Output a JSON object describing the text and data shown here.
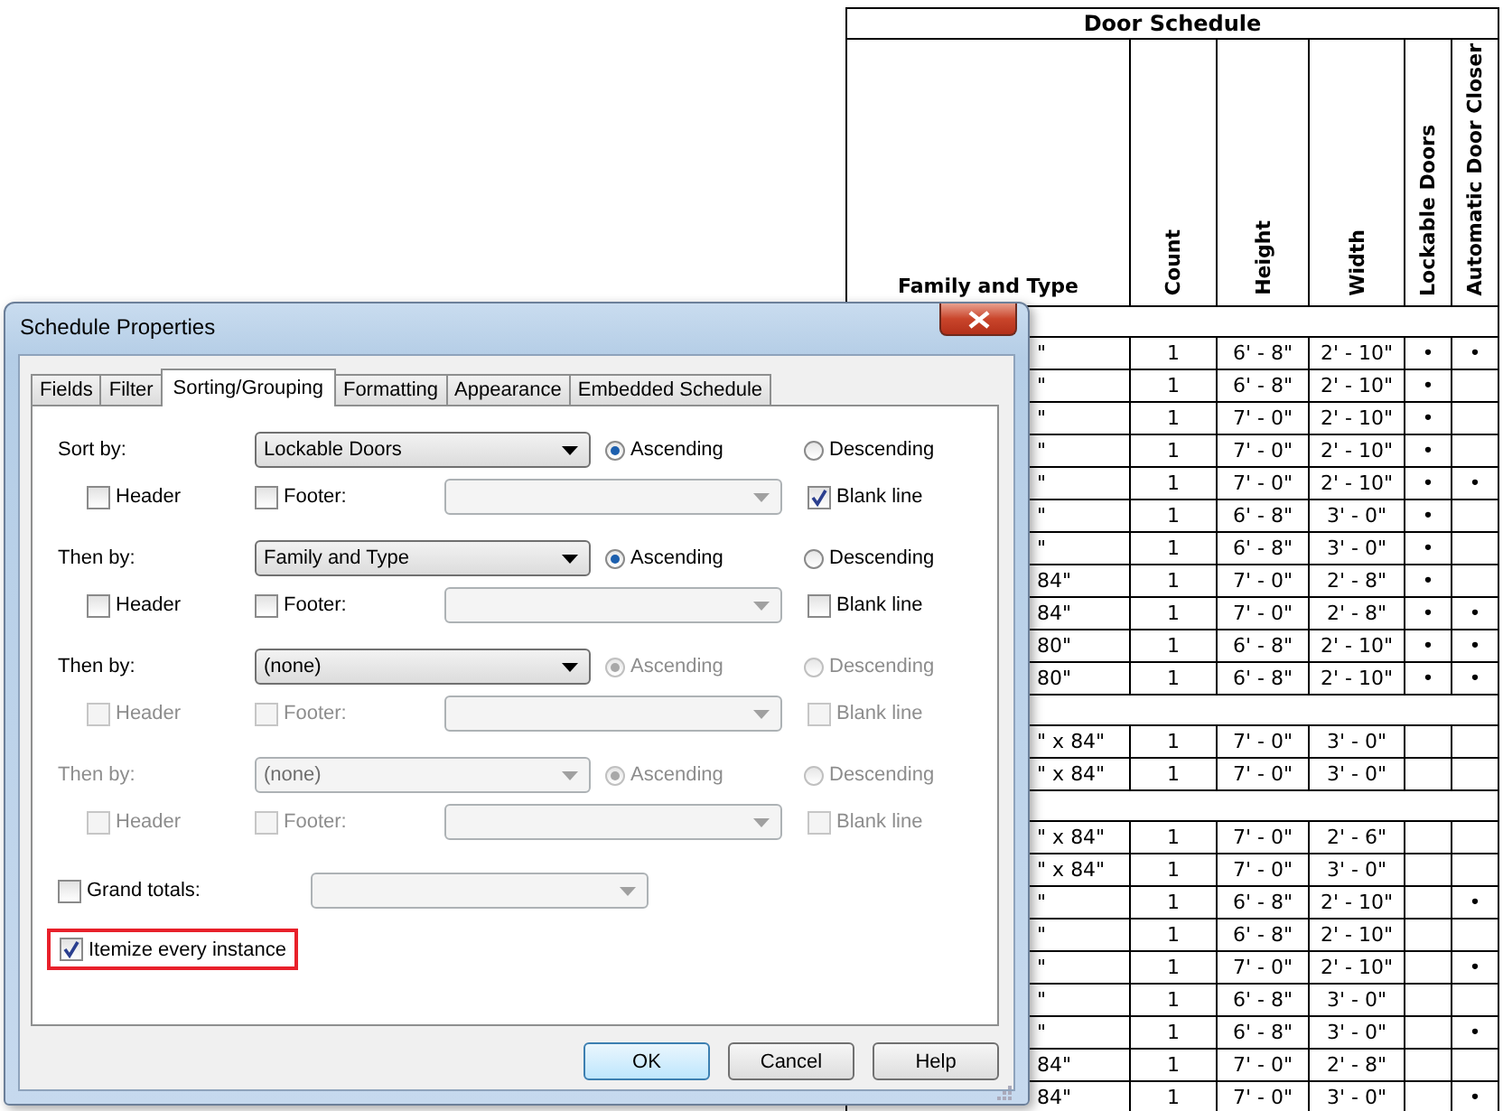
{
  "schedule": {
    "title": "Door Schedule",
    "columns": [
      {
        "label": "Family and Type",
        "vertical": false
      },
      {
        "label": "Count",
        "vertical": true
      },
      {
        "label": "Height",
        "vertical": true
      },
      {
        "label": "Width",
        "vertical": true
      },
      {
        "label": "Lockable Doors",
        "vertical": true
      },
      {
        "label": "Automatic Door Closer",
        "vertical": true
      }
    ],
    "groups": [
      {
        "rows": [
          [
            "\"",
            "1",
            "6' - 8\"",
            "2' - 10\"",
            "•",
            "•"
          ],
          [
            "\"",
            "1",
            "6' - 8\"",
            "2' - 10\"",
            "•",
            null
          ],
          [
            "\"",
            "1",
            "7' - 0\"",
            "2' - 10\"",
            "•",
            null
          ],
          [
            "\"",
            "1",
            "7' - 0\"",
            "2' - 10\"",
            "•",
            null
          ],
          [
            "\"",
            "1",
            "7' - 0\"",
            "2' - 10\"",
            "•",
            "•"
          ],
          [
            "\"",
            "1",
            "6' - 8\"",
            "3' - 0\"",
            "•",
            null
          ],
          [
            "\"",
            "1",
            "6' - 8\"",
            "3' - 0\"",
            "•",
            null
          ],
          [
            "84\"",
            "1",
            "7' - 0\"",
            "2' - 8\"",
            "•",
            null
          ],
          [
            "84\"",
            "1",
            "7' - 0\"",
            "2' - 8\"",
            "•",
            "•"
          ],
          [
            "80\"",
            "1",
            "6' - 8\"",
            "2' - 10\"",
            "•",
            "•"
          ],
          [
            "80\"",
            "1",
            "6' - 8\"",
            "2' - 10\"",
            "•",
            "•"
          ]
        ]
      },
      {
        "rows": [
          [
            "\" x 84\"",
            "1",
            "7' - 0\"",
            "3' - 0\"",
            null,
            null
          ],
          [
            "\" x 84\"",
            "1",
            "7' - 0\"",
            "3' - 0\"",
            null,
            null
          ]
        ]
      },
      {
        "rows": [
          [
            "\" x 84\"",
            "1",
            "7' - 0\"",
            "2' - 6\"",
            null,
            null
          ],
          [
            "\" x 84\"",
            "1",
            "7' - 0\"",
            "3' - 0\"",
            null,
            null
          ],
          [
            "\"",
            "1",
            "6' - 8\"",
            "2' - 10\"",
            null,
            "•"
          ],
          [
            "\"",
            "1",
            "6' - 8\"",
            "2' - 10\"",
            null,
            null
          ],
          [
            "\"",
            "1",
            "7' - 0\"",
            "2' - 10\"",
            null,
            "•"
          ],
          [
            "\"",
            "1",
            "6' - 8\"",
            "3' - 0\"",
            null,
            null
          ],
          [
            "\"",
            "1",
            "6' - 8\"",
            "3' - 0\"",
            null,
            "•"
          ],
          [
            "84\"",
            "1",
            "7' - 0\"",
            "2' - 8\"",
            null,
            null
          ],
          [
            "84\"",
            "1",
            "7' - 0\"",
            "3' - 0\"",
            null,
            "•"
          ]
        ]
      }
    ]
  },
  "dialog": {
    "title": "Schedule Properties",
    "tabs": [
      {
        "label": "Fields",
        "selected": false
      },
      {
        "label": "Filter",
        "selected": false
      },
      {
        "label": "Sorting/Grouping",
        "selected": true
      },
      {
        "label": "Formatting",
        "selected": false
      },
      {
        "label": "Appearance",
        "selected": false
      },
      {
        "label": "Embedded Schedule",
        "selected": false
      }
    ],
    "sort_groups": [
      {
        "label": "Sort by:",
        "disabled": false,
        "field": {
          "value": "Lockable Doors",
          "disabled": false
        },
        "ascending": {
          "label": "Ascending",
          "selected": true,
          "disabled": false
        },
        "descending": {
          "label": "Descending",
          "selected": false,
          "disabled": false
        },
        "header": {
          "label": "Header",
          "checked": false,
          "disabled": false
        },
        "footer": {
          "label": "Footer:",
          "checked": false,
          "disabled": false
        },
        "blank_line": {
          "label": "Blank line",
          "checked": true,
          "disabled": false
        }
      },
      {
        "label": "Then by:",
        "disabled": false,
        "field": {
          "value": "Family and Type",
          "disabled": false
        },
        "ascending": {
          "label": "Ascending",
          "selected": true,
          "disabled": false
        },
        "descending": {
          "label": "Descending",
          "selected": false,
          "disabled": false
        },
        "header": {
          "label": "Header",
          "checked": false,
          "disabled": false
        },
        "footer": {
          "label": "Footer:",
          "checked": false,
          "disabled": false
        },
        "blank_line": {
          "label": "Blank line",
          "checked": false,
          "disabled": false
        }
      },
      {
        "label": "Then by:",
        "disabled": false,
        "field": {
          "value": "(none)",
          "disabled": false
        },
        "ascending": {
          "label": "Ascending",
          "selected": true,
          "disabled": true
        },
        "descending": {
          "label": "Descending",
          "selected": false,
          "disabled": true
        },
        "header": {
          "label": "Header",
          "checked": false,
          "disabled": true
        },
        "footer": {
          "label": "Footer:",
          "checked": false,
          "disabled": true
        },
        "blank_line": {
          "label": "Blank line",
          "checked": false,
          "disabled": true
        }
      },
      {
        "label": "Then by:",
        "disabled": true,
        "field": {
          "value": "(none)",
          "disabled": true
        },
        "ascending": {
          "label": "Ascending",
          "selected": true,
          "disabled": true
        },
        "descending": {
          "label": "Descending",
          "selected": false,
          "disabled": true
        },
        "header": {
          "label": "Header",
          "checked": false,
          "disabled": true
        },
        "footer": {
          "label": "Footer:",
          "checked": false,
          "disabled": true
        },
        "blank_line": {
          "label": "Blank line",
          "checked": false,
          "disabled": true
        }
      }
    ],
    "grand_totals": {
      "label": "Grand totals:",
      "checked": false
    },
    "itemize": {
      "label": "Itemize every instance",
      "checked": true,
      "highlighted": true
    },
    "buttons": [
      {
        "label": "OK",
        "default": true
      },
      {
        "label": "Cancel",
        "default": false
      },
      {
        "label": "Help",
        "default": false
      }
    ]
  }
}
